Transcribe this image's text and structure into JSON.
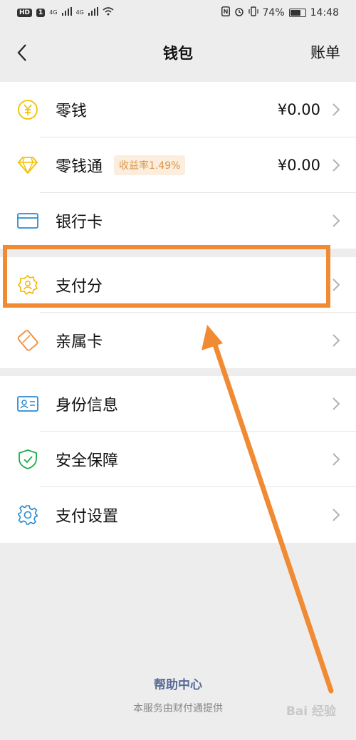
{
  "status_bar": {
    "left_badges": [
      "HD",
      "1",
      "4G",
      "4G"
    ],
    "battery": "74%",
    "battery_level": 0.74,
    "time": "14:48"
  },
  "nav": {
    "title": "钱包",
    "right": "账单"
  },
  "group1": [
    {
      "label": "零钱",
      "value": "¥0.00"
    },
    {
      "label": "零钱通",
      "badge": "收益率1.49%",
      "value": "¥0.00"
    },
    {
      "label": "银行卡"
    }
  ],
  "group2": [
    {
      "label": "支付分"
    },
    {
      "label": "亲属卡"
    }
  ],
  "group3": [
    {
      "label": "身份信息"
    },
    {
      "label": "安全保障"
    },
    {
      "label": "支付设置"
    }
  ],
  "footer": {
    "help": "帮助中心",
    "provider": "本服务由财付通提供"
  },
  "watermark": "Bai 经验",
  "colors": {
    "highlight": "#f08a33",
    "link": "#576b95",
    "coin": "#f2c200",
    "blue": "#2a8bd2",
    "green": "#1aad4b"
  }
}
